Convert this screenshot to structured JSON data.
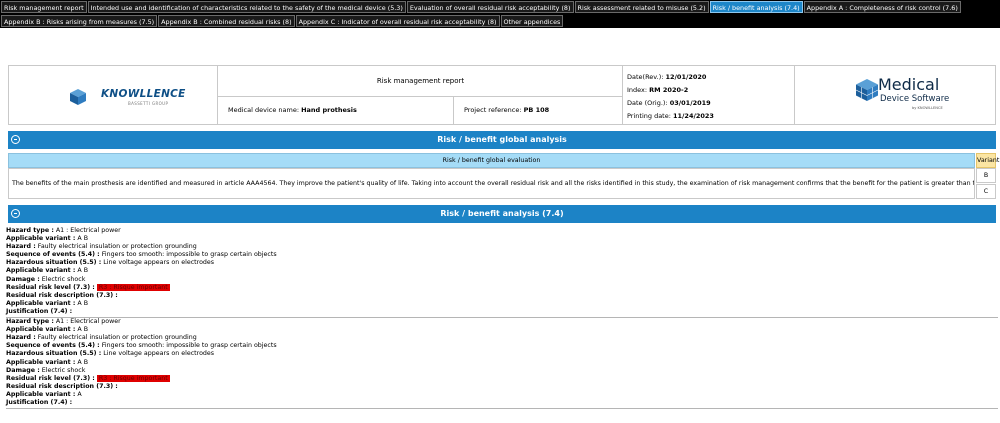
{
  "tabs": {
    "row1": [
      "Risk management report",
      "Intended use and identification of characteristics related to the safety of the medical device (5.3)",
      "Evaluation of overall residual risk acceptability (8)",
      "Risk assessment related to misuse (5.2)",
      "Risk / benefit analysis (7.4)",
      "Appendix A : Completeness of risk control (7.6)"
    ],
    "row2": [
      "Appendix B : Risks arising from measures (7.5)",
      "Appendix B : Combined residual risks (8)",
      "Appendix C : Indicator of overall residual risk acceptability (8)",
      "Other appendices"
    ],
    "active": "Risk / benefit analysis (7.4)"
  },
  "header": {
    "left_logo": {
      "brand": "KNOWLLENCE",
      "sub": "BASSETTI GROUP"
    },
    "report_title": "Risk management report",
    "device_label": "Medical device name:",
    "device_value": "Hand prothesis",
    "project_label": "Project reference:",
    "project_value": "PB 108",
    "date_rev_label": "Date(Rev.):",
    "date_rev_value": "12/01/2020",
    "index_label": "Index:",
    "index_value": "RM 2020-2",
    "date_orig_label": "Date (Orig.):",
    "date_orig_value": "03/01/2019",
    "printing_label": "Printing date:",
    "printing_value": "11/24/2023",
    "right_logo": {
      "line1": "Medical",
      "line2": "Device Software",
      "line3": "by KNOWLLENCE"
    }
  },
  "global_section": {
    "title": "Risk / benefit global analysis",
    "table_header": "Risk / benefit global evaluation",
    "variant_header": "Variant",
    "text": "The benefits of the main prosthesis are identified and measured in article AAA4564. They improve the patient's quality of life. Taking into account the overall residual risk and all the risks identified in this study, the examination of risk management confirms that the benefit for the patient is greater than the risks incurred.",
    "variants": [
      "B",
      "C"
    ]
  },
  "analysis_section": {
    "title": "Risk / benefit analysis (7.4)",
    "entries": [
      {
        "hazard_type": "A1 : Electrical power",
        "applicable_variant_1": "A B",
        "hazard": "Faulty electrical insulation or protection grounding",
        "sequence_of_events": "Fingers too smooth: impossible to grasp certain objects",
        "hazardous_situation": "Line voltage appears on electrodes",
        "applicable_variant_2": "A B",
        "damage": "Electric shock",
        "residual_risk_level": "R3 : Risque important",
        "residual_risk_description": "",
        "applicable_variant_3": "A B",
        "justification": ""
      },
      {
        "hazard_type": "A1 : Electrical power",
        "applicable_variant_1": "A B",
        "hazard": "Faulty electrical insulation or protection grounding",
        "sequence_of_events": "Fingers too smooth: impossible to grasp certain objects",
        "hazardous_situation": "Line voltage appears on electrodes",
        "applicable_variant_2": "A B",
        "damage": "Electric shock",
        "residual_risk_level": "R3 : Risque important",
        "residual_risk_description": "",
        "applicable_variant_3": "A",
        "justification": ""
      }
    ]
  },
  "labels": {
    "hazard_type": "Hazard type :",
    "applicable_variant": "Applicable variant :",
    "hazard": "Hazard :",
    "sequence_of_events": "Sequence of events (5.4) :",
    "hazardous_situation": "Hazardous situation (5.5) :",
    "damage": "Damage :",
    "residual_risk_level": "Residual risk level (7.3) :",
    "residual_risk_description": "Residual risk description (7.3) :",
    "justification": "Justification (7.4) :"
  },
  "colors": {
    "tab_active": "#1d86c8",
    "section_bar": "#1c83c6",
    "table_header": "#a5dcf7",
    "variant_header": "#fbe5a3",
    "risk_badge": "#e00000"
  }
}
